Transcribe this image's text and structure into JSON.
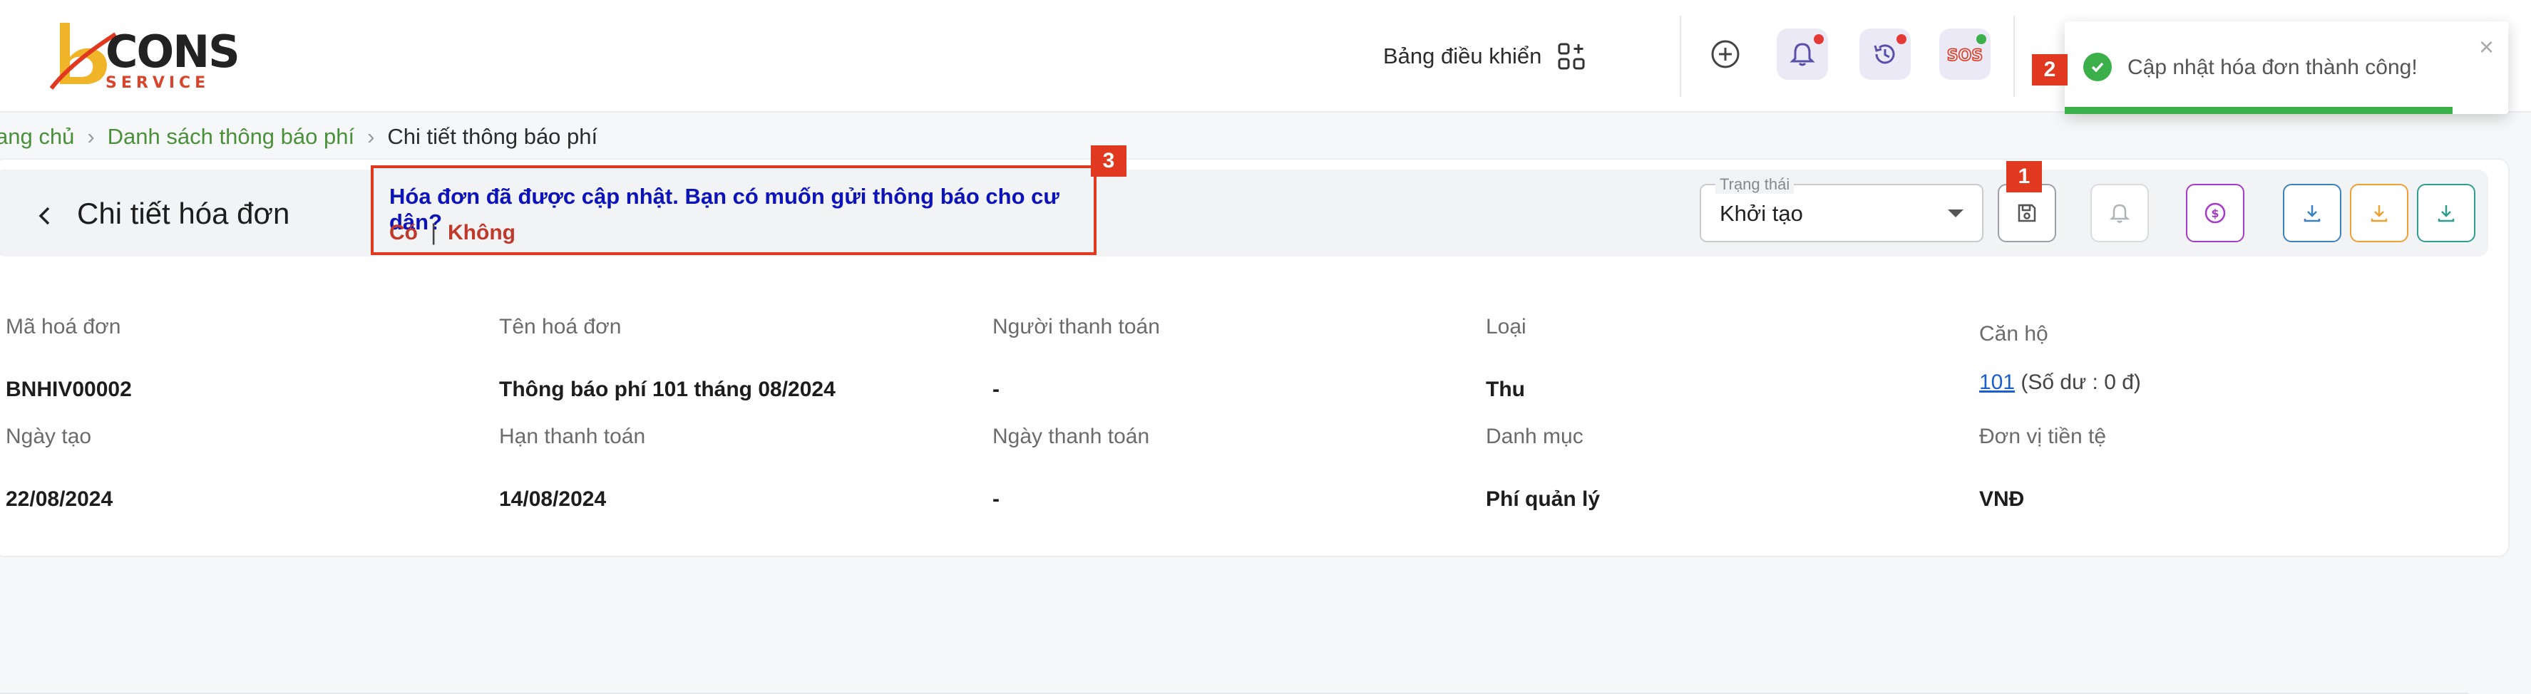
{
  "header": {
    "logo_text": "CONS",
    "logo_sub": "SERVICE",
    "dashboard_label": "Bảng điều khiển"
  },
  "toast": {
    "message": "Cập nhật hóa đơn thành công!",
    "close": "×",
    "progress": 0.875
  },
  "tags": {
    "one": "1",
    "two": "2",
    "three": "3"
  },
  "breadcrumb": {
    "home": "ang chủ",
    "list": "Danh sách thông báo phí",
    "current": "Chi tiết thông báo phí",
    "sep": "›"
  },
  "page": {
    "title": "Chi tiết hóa đơn"
  },
  "confirm": {
    "question": "Hóa đơn đã được cập nhật. Bạn có muốn gửi thông báo cho cư dân?",
    "yes": "Có",
    "separator": "|",
    "no": "Không"
  },
  "status": {
    "label": "Trạng thái",
    "value": "Khởi tạo"
  },
  "fields": {
    "code_label": "Mã hoá đơn",
    "code": "BNHIV00002",
    "name_label": "Tên hoá đơn",
    "name": "Thông báo phí 101 tháng 08/2024",
    "payer_label": "Người thanh toán",
    "payer": "-",
    "type_label": "Loại",
    "type": "Thu",
    "apt_label": "Căn hộ",
    "apt": "101",
    "apt_balance": "(Số dư : 0 đ)",
    "created_label": "Ngày tạo",
    "created": "22/08/2024",
    "due_label": "Hạn thanh toán",
    "due": "14/08/2024",
    "paid_label": "Ngày thanh toán",
    "paid": "-",
    "category_label": "Danh mục",
    "category": "Phí quản lý",
    "currency_label": "Đơn vị tiền tệ",
    "currency": "VNĐ"
  },
  "colors": {
    "accent_green": "#3aaf4a",
    "tag_red": "#e0391f",
    "question_blue": "#0c13b8",
    "link_green": "#4a8f3a"
  },
  "icons": [
    "apps-icon",
    "plus-circle-icon",
    "bell-icon",
    "history-icon",
    "sos-icon",
    "check-circle-icon",
    "close-icon",
    "chevron-left-icon",
    "save-icon",
    "bell-outline-icon",
    "dollar-icon",
    "download-icon"
  ]
}
